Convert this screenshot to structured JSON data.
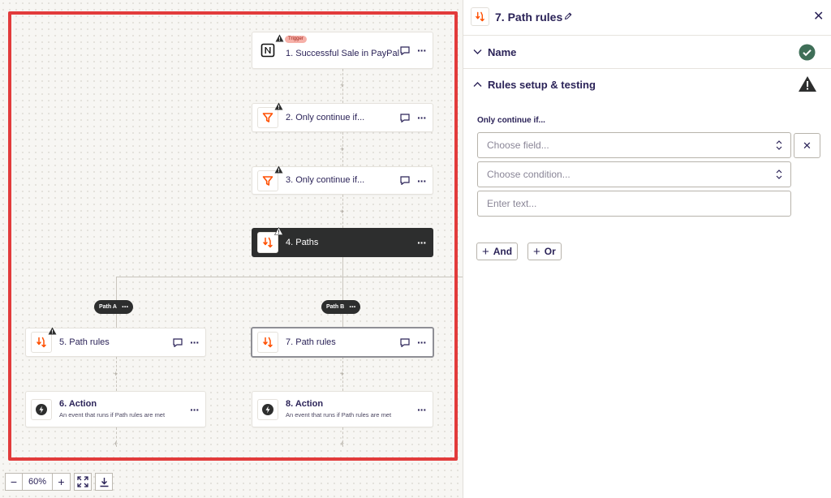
{
  "canvas": {
    "nodes": [
      {
        "id": "n1",
        "tag": "Trigger",
        "label": "1. Successful Sale in PayPal",
        "icon": "notion-icon"
      },
      {
        "id": "n2",
        "label": "2. Only continue if...",
        "icon": "filter-icon"
      },
      {
        "id": "n3",
        "label": "3. Only continue if...",
        "icon": "filter-icon"
      },
      {
        "id": "n4",
        "label": "4. Paths",
        "icon": "paths-icon"
      },
      {
        "id": "n5",
        "label": "5. Path rules",
        "icon": "paths-icon"
      },
      {
        "id": "n6",
        "label": "6. Action",
        "sub": "An event that runs if Path rules are met",
        "icon": "bolt-icon"
      },
      {
        "id": "n7",
        "label": "7. Path rules",
        "icon": "paths-icon"
      },
      {
        "id": "n8",
        "label": "8. Action",
        "sub": "An event that runs if Path rules are met",
        "icon": "bolt-icon"
      }
    ],
    "paths": [
      {
        "label": "Path A"
      },
      {
        "label": "Path B"
      }
    ]
  },
  "zoom": {
    "minus": "−",
    "level": "60%",
    "plus": "+"
  },
  "panel": {
    "title": "7. Path rules",
    "sections": {
      "name": {
        "label": "Name",
        "status": "complete"
      },
      "rules": {
        "label": "Rules setup & testing",
        "status": "warning"
      }
    },
    "rules_heading": "Only continue if...",
    "field_placeholder": "Choose field...",
    "condition_placeholder": "Choose condition...",
    "text_placeholder": "Enter text...",
    "and_label": "And",
    "or_label": "Or"
  },
  "colors": {
    "accent_orange": "#ff4f00",
    "highlight_red": "#e23b3b",
    "success_green": "#3f6f58",
    "dark_node": "#2d2e2e"
  }
}
